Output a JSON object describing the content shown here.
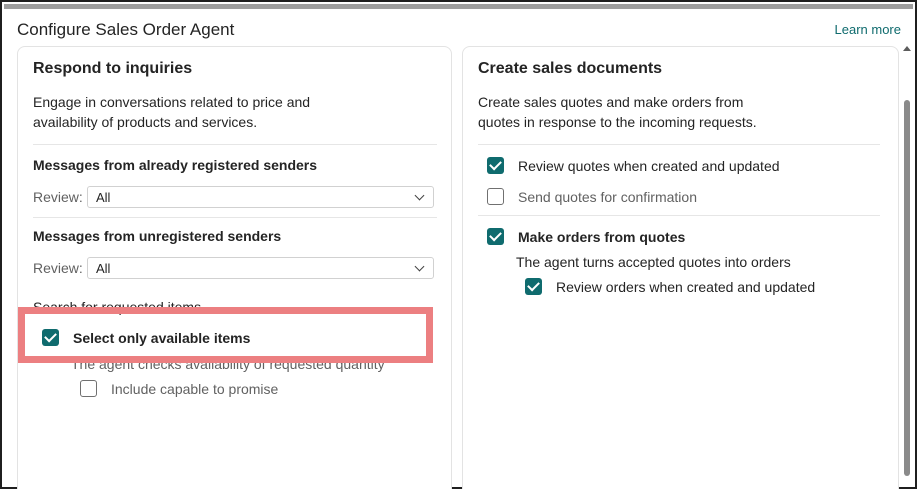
{
  "dialog": {
    "title": "Configure Sales Order Agent",
    "learn_more": "Learn more"
  },
  "inquiries": {
    "title": "Respond to inquiries",
    "description_line1": "Engage in conversations related to price and",
    "description_line2": "availability of products and services.",
    "registered": {
      "label": "Messages from already registered senders",
      "review_label": "Review:",
      "review_value": "All"
    },
    "unregistered": {
      "label": "Messages from unregistered senders",
      "review_label": "Review:",
      "review_value": "All"
    },
    "search": {
      "label": "Search for requested items",
      "available_only": {
        "label": "Select only available items",
        "checked": true
      },
      "helper": "The agent checks availability of requested quantity",
      "capable_to_promise": {
        "label": "Include capable to promise",
        "checked": false
      }
    }
  },
  "sales_docs": {
    "title": "Create sales documents",
    "description_line1": "Create sales quotes and make orders from",
    "description_line2": "quotes in response to the incoming requests.",
    "review_quotes": {
      "label": "Review quotes when created and updated",
      "checked": true
    },
    "send_quotes": {
      "label": "Send quotes for confirmation",
      "checked": false
    },
    "make_orders": {
      "label": "Make orders from quotes",
      "checked": true
    },
    "orders_helper": "The agent turns accepted quotes into orders",
    "review_orders": {
      "label": "Review orders when created and updated",
      "checked": true
    }
  },
  "colors": {
    "accent": "#0f6b6e",
    "highlight": "#ec7f81"
  }
}
